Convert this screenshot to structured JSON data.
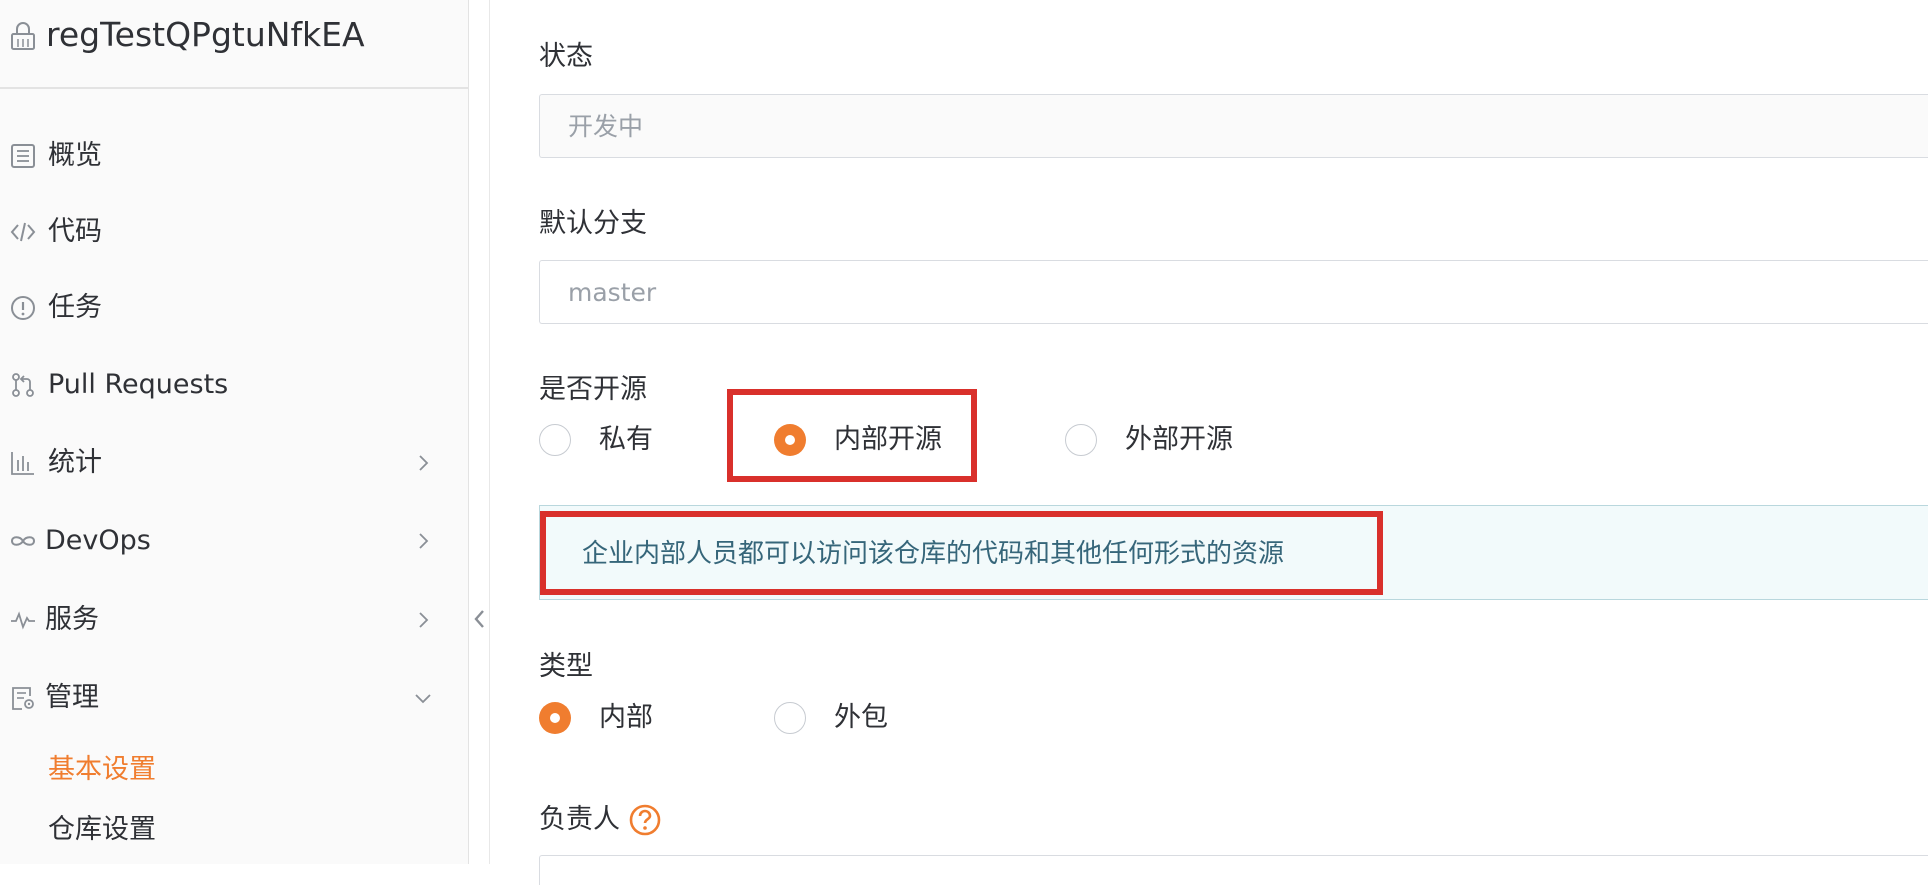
{
  "sidebar": {
    "repo_name": "regTestQPgtuNfkEA",
    "repo_icon": "lock-icon",
    "items": [
      {
        "label": "概览",
        "icon": "overview-icon"
      },
      {
        "label": "代码",
        "icon": "code-icon"
      },
      {
        "label": "任务",
        "icon": "issue-icon"
      },
      {
        "label": "Pull Requests",
        "icon": "pull-request-icon"
      },
      {
        "label": "统计",
        "icon": "chart-icon",
        "chevron": "right"
      },
      {
        "label": "DevOps",
        "icon": "infinity-icon",
        "chevron": "right"
      },
      {
        "label": "服务",
        "icon": "pulse-icon",
        "chevron": "right"
      },
      {
        "label": "管理",
        "icon": "settings-doc-icon",
        "chevron": "down",
        "expanded": true
      }
    ],
    "subitems": [
      {
        "label": "基本设置",
        "active": true
      },
      {
        "label": "仓库设置",
        "active": false
      }
    ]
  },
  "form": {
    "status": {
      "label": "状态",
      "placeholder": "开发中"
    },
    "default_branch": {
      "label": "默认分支",
      "placeholder": "master"
    },
    "open_source": {
      "label": "是否开源",
      "options": [
        {
          "label": "私有",
          "checked": false
        },
        {
          "label": "内部开源",
          "checked": true
        },
        {
          "label": "外部开源",
          "checked": false
        }
      ],
      "info": "企业内部人员都可以访问该仓库的代码和其他任何形式的资源"
    },
    "type": {
      "label": "类型",
      "options": [
        {
          "label": "内部",
          "checked": true
        },
        {
          "label": "外包",
          "checked": false
        }
      ]
    },
    "assignee": {
      "label": "负责人",
      "help_icon": "help-icon"
    }
  },
  "colors": {
    "accent": "#f07d2f",
    "highlight": "#d9302b",
    "info_text": "#36667a",
    "info_bg": "#f2fafb"
  }
}
